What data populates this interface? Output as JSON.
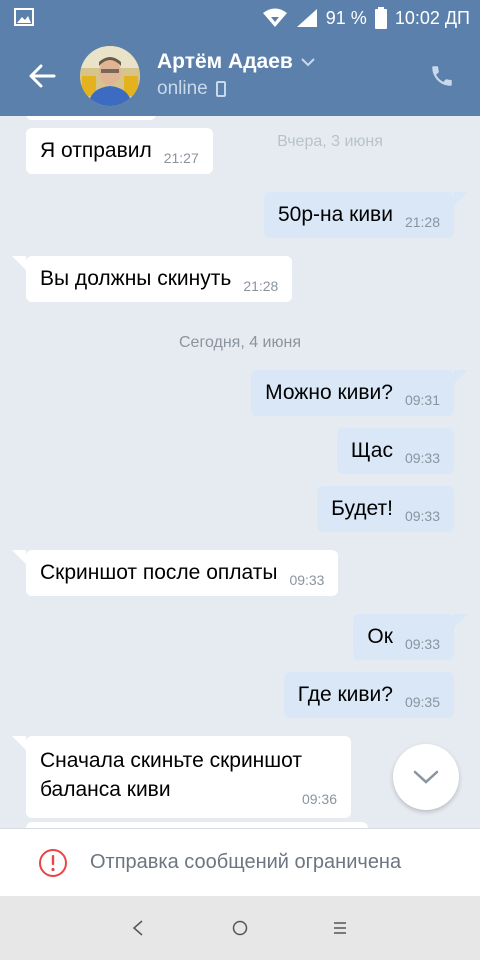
{
  "status_bar": {
    "battery": "91 %",
    "time": "10:02 ДП"
  },
  "header": {
    "name": "Артём Адаев",
    "status": "online"
  },
  "chat": {
    "faded_date": "Вчера, 3 июня",
    "date_today": "Сегодня, 4 июня",
    "messages": [
      {
        "text": "Я отправил",
        "time": "21:27"
      },
      {
        "text": "50р-на киви",
        "time": "21:28"
      },
      {
        "text": "Вы должны скинуть",
        "time": "21:28"
      },
      {
        "text": "Можно киви?",
        "time": "09:31"
      },
      {
        "text": "Щас",
        "time": "09:33"
      },
      {
        "text": "Будет!",
        "time": "09:33"
      },
      {
        "text": "Скриншот после оплаты",
        "time": "09:33"
      },
      {
        "text": "Ок",
        "time": "09:33"
      },
      {
        "text": "Где киви?",
        "time": "09:35"
      },
      {
        "line1": "Сначала скиньте скриншот",
        "line2": "баланса киви",
        "time": "09:36"
      }
    ]
  },
  "restricted": {
    "text": "Отправка сообщений ограничена"
  },
  "colors": {
    "header_bg": "#5b80ab",
    "incoming_bubble": "#ffffff",
    "outgoing_bubble": "#d9e7f7",
    "warning": "#e64646"
  }
}
